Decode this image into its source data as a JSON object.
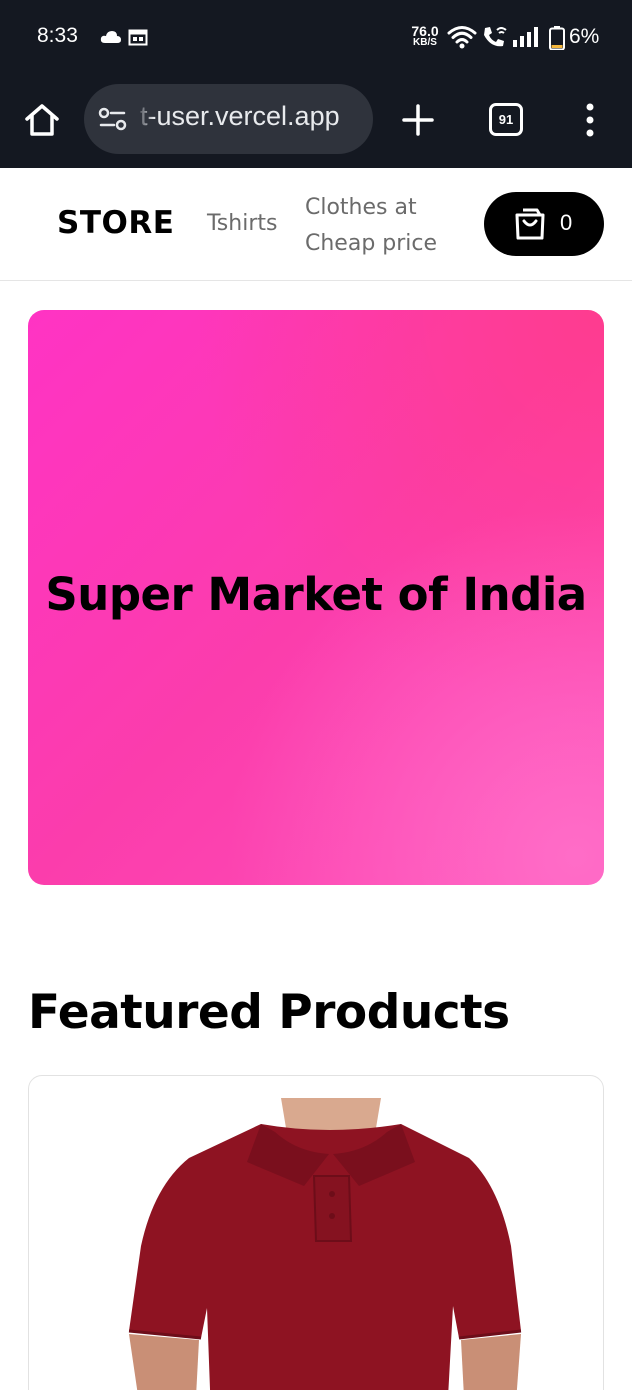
{
  "status_bar": {
    "time": "8:33",
    "net_speed_value": "76.0",
    "net_speed_unit": "KB/S",
    "battery": "6%"
  },
  "browser": {
    "url": "t-user.vercel.app",
    "tab_count": "91"
  },
  "header": {
    "logo": "STORE",
    "nav": [
      {
        "label": "Tshirts"
      },
      {
        "label": "Clothes at Cheap price"
      }
    ],
    "cart_count": "0"
  },
  "hero": {
    "title": "Super Market of India"
  },
  "featured": {
    "title": "Featured Products",
    "products": [
      {
        "image": "maroon-polo-tshirt",
        "color": "#8e1322"
      }
    ]
  },
  "colors": {
    "status_bg": "#141821",
    "url_pill": "#2f333c",
    "hero_pink": "#ff33c4",
    "cart_bg": "#000000"
  }
}
